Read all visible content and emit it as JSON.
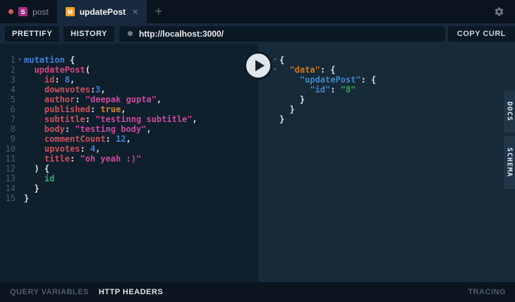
{
  "tabbar": {
    "tabs": [
      {
        "badge": "S",
        "badge_color": "#a62c84",
        "label": "post",
        "dirty": true,
        "active": false
      },
      {
        "badge": "M",
        "badge_color": "#eea127",
        "label": "updatePost",
        "dirty": false,
        "active": true
      }
    ]
  },
  "icons": {
    "close": "×",
    "new_tab": "+",
    "fold": "▾",
    "gear": "settings-gear",
    "play": "run-query-play",
    "url_dot": "server-status-dot"
  },
  "toolbar": {
    "prettify": "PRETTIFY",
    "history": "HISTORY",
    "url": "http://localhost:3000/",
    "copy_curl": "COPY CURL"
  },
  "editor": {
    "lines": [
      {
        "num": "1",
        "fold": true,
        "tokens": [
          {
            "c": "kw",
            "t": "mutation"
          },
          {
            "c": "p",
            "t": " {"
          }
        ]
      },
      {
        "num": "2",
        "fold": false,
        "tokens": [
          {
            "c": "p",
            "t": "  "
          },
          {
            "c": "fld",
            "t": "updatePost"
          },
          {
            "c": "p",
            "t": "("
          }
        ]
      },
      {
        "num": "3",
        "fold": false,
        "tokens": [
          {
            "c": "p",
            "t": "    "
          },
          {
            "c": "attr",
            "t": "id"
          },
          {
            "c": "p",
            "t": ": "
          },
          {
            "c": "num",
            "t": "8"
          },
          {
            "c": "p",
            "t": ","
          }
        ]
      },
      {
        "num": "4",
        "fold": false,
        "tokens": [
          {
            "c": "p",
            "t": "    "
          },
          {
            "c": "attr",
            "t": "downvotes"
          },
          {
            "c": "p",
            "t": ":"
          },
          {
            "c": "num",
            "t": "3"
          },
          {
            "c": "p",
            "t": ","
          }
        ]
      },
      {
        "num": "5",
        "fold": false,
        "tokens": [
          {
            "c": "p",
            "t": "    "
          },
          {
            "c": "attr",
            "t": "author"
          },
          {
            "c": "p",
            "t": ": "
          },
          {
            "c": "str",
            "t": "\"deepak gupta\""
          },
          {
            "c": "p",
            "t": ","
          }
        ]
      },
      {
        "num": "6",
        "fold": false,
        "tokens": [
          {
            "c": "p",
            "t": "    "
          },
          {
            "c": "attr",
            "t": "published"
          },
          {
            "c": "p",
            "t": ": "
          },
          {
            "c": "bool",
            "t": "true"
          },
          {
            "c": "p",
            "t": ","
          }
        ]
      },
      {
        "num": "7",
        "fold": false,
        "tokens": [
          {
            "c": "p",
            "t": "    "
          },
          {
            "c": "attr",
            "t": "subtitle"
          },
          {
            "c": "p",
            "t": ": "
          },
          {
            "c": "str",
            "t": "\"testinng subtitle\""
          },
          {
            "c": "p",
            "t": ","
          }
        ]
      },
      {
        "num": "8",
        "fold": false,
        "tokens": [
          {
            "c": "p",
            "t": "    "
          },
          {
            "c": "attr",
            "t": "body"
          },
          {
            "c": "p",
            "t": ": "
          },
          {
            "c": "str",
            "t": "\"testing body\""
          },
          {
            "c": "p",
            "t": ","
          }
        ]
      },
      {
        "num": "9",
        "fold": false,
        "tokens": [
          {
            "c": "p",
            "t": "    "
          },
          {
            "c": "attr",
            "t": "commentCount"
          },
          {
            "c": "p",
            "t": ": "
          },
          {
            "c": "num",
            "t": "12"
          },
          {
            "c": "p",
            "t": ","
          }
        ]
      },
      {
        "num": "10",
        "fold": false,
        "tokens": [
          {
            "c": "p",
            "t": "    "
          },
          {
            "c": "attr",
            "t": "upvotes"
          },
          {
            "c": "p",
            "t": ": "
          },
          {
            "c": "num",
            "t": "4"
          },
          {
            "c": "p",
            "t": ","
          }
        ]
      },
      {
        "num": "11",
        "fold": false,
        "tokens": [
          {
            "c": "p",
            "t": "    "
          },
          {
            "c": "attr",
            "t": "title"
          },
          {
            "c": "p",
            "t": ": "
          },
          {
            "c": "str",
            "t": "\"oh yeah :)\""
          }
        ]
      },
      {
        "num": "12",
        "fold": false,
        "tokens": [
          {
            "c": "p",
            "t": "  "
          },
          {
            "c": "p",
            "t": ") {"
          }
        ]
      },
      {
        "num": "13",
        "fold": false,
        "tokens": [
          {
            "c": "p",
            "t": "    "
          },
          {
            "c": "prop",
            "t": "id"
          }
        ]
      },
      {
        "num": "14",
        "fold": false,
        "tokens": [
          {
            "c": "p",
            "t": "  "
          },
          {
            "c": "p",
            "t": "}"
          }
        ]
      },
      {
        "num": "15",
        "fold": false,
        "tokens": [
          {
            "c": "p",
            "t": "}"
          }
        ]
      }
    ]
  },
  "result": {
    "lines": [
      {
        "fold": true,
        "tokens": [
          {
            "c": "p",
            "t": "{"
          }
        ]
      },
      {
        "fold": true,
        "tokens": [
          {
            "c": "p",
            "t": "  "
          },
          {
            "c": "key1",
            "t": "\"data\""
          },
          {
            "c": "p",
            "t": ": {"
          }
        ]
      },
      {
        "fold": false,
        "tokens": [
          {
            "c": "p",
            "t": "    "
          },
          {
            "c": "key2",
            "t": "\"updatePost\""
          },
          {
            "c": "p",
            "t": ": {"
          }
        ]
      },
      {
        "fold": false,
        "tokens": [
          {
            "c": "p",
            "t": "      "
          },
          {
            "c": "key2",
            "t": "\"id\""
          },
          {
            "c": "p",
            "t": ": "
          },
          {
            "c": "strg",
            "t": "\"8\""
          }
        ]
      },
      {
        "fold": false,
        "tokens": [
          {
            "c": "p",
            "t": "    }"
          }
        ]
      },
      {
        "fold": false,
        "tokens": [
          {
            "c": "p",
            "t": "  }"
          }
        ]
      },
      {
        "fold": false,
        "tokens": [
          {
            "c": "p",
            "t": "}"
          }
        ]
      }
    ]
  },
  "side_tabs": {
    "docs": "DOCS",
    "schema": "SCHEMA"
  },
  "bottom": {
    "query_variables": "QUERY VARIABLES",
    "http_headers": "HTTP HEADERS",
    "tracing": "TRACING"
  },
  "colors": {
    "tab_s_badge": "#a62c84",
    "tab_m_badge": "#eea127",
    "dirty_dot": "#d65b49",
    "editor_bg": "#0f1f2c",
    "result_bg": "#172a3a",
    "tabbar_bg": "#0a141f",
    "keyword_blue": "#3f80d4",
    "argument_red": "#cd4f5d",
    "string_magenta": "#c9499c",
    "field_green": "#3aa76d",
    "json_key_orange": "#d47509",
    "json_key_blue": "#3f86c8",
    "json_string_green": "#2da44e"
  }
}
